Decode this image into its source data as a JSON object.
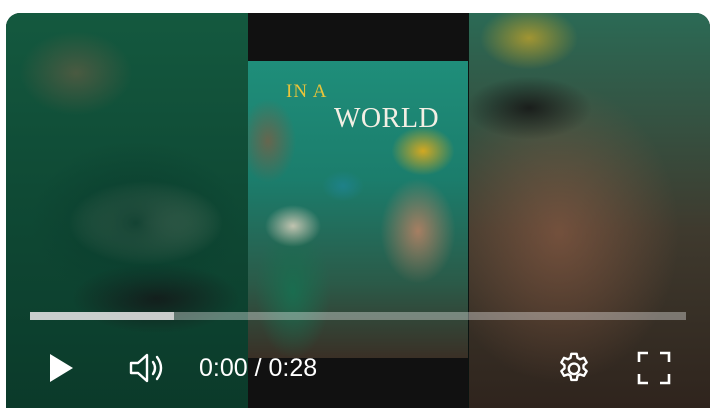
{
  "video": {
    "title_line1": "IN A",
    "title_line2": "WORLD",
    "progress_buffered": 0.22,
    "progress_played": 0.0
  },
  "controls": {
    "play_icon": "play-icon",
    "volume_icon": "volume-icon",
    "settings_icon": "gear-icon",
    "fullscreen_icon": "fullscreen-icon",
    "current_time": "0:00",
    "separator": " / ",
    "duration": "0:28"
  },
  "colors": {
    "accent_title": "#e9c43a",
    "controls": "#ffffff"
  }
}
